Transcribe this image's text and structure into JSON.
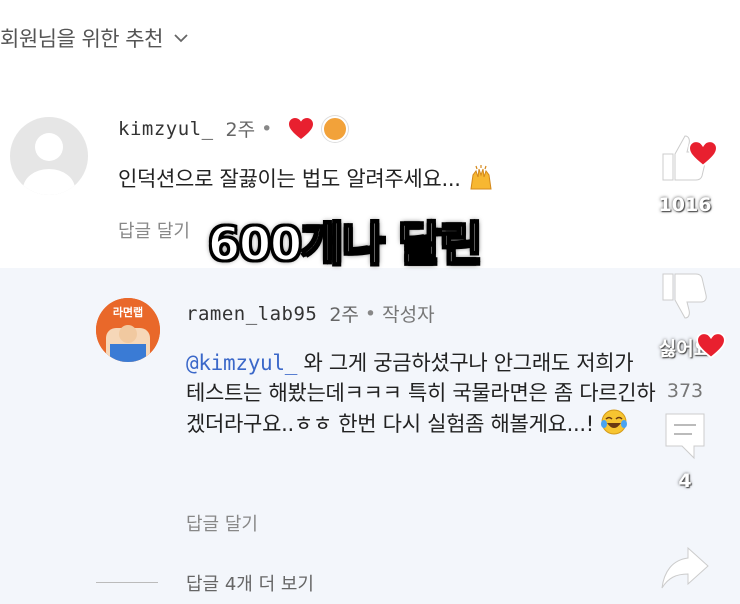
{
  "header": {
    "title": "회원님을 위한 추천"
  },
  "overlay": {
    "title": "600개나 달린"
  },
  "comments": [
    {
      "username": "kimzyul_",
      "time": "2주",
      "text": "인덕션으로 잘끓이는 법도 알려주세요...",
      "reply_label": "답글 달기"
    },
    {
      "username": "ramen_lab95",
      "time": "2주",
      "author_badge": "작성자",
      "avatar_text": "라면랩",
      "mention": "@kimzyul_",
      "text": " 와 그게 궁금하셨구나 안그래도 저희가 테스트는 해봤는데ㅋㅋㅋ 특히 국물라면은 좀 다르긴하겠더라구요..ㅎㅎ 한번 다시 실험좀 해볼게요...!",
      "reply_label": "답글 달기"
    }
  ],
  "replies": {
    "more_label": "답글 4개 더 보기"
  },
  "rail": {
    "like_count": "1016",
    "dislike_label": "싫어요",
    "dislike_count": "373",
    "comment_count": "4"
  },
  "colors": {
    "heart": "#e8202f",
    "mention": "#3b68c9",
    "reply_bg": "#f3f6fb"
  }
}
